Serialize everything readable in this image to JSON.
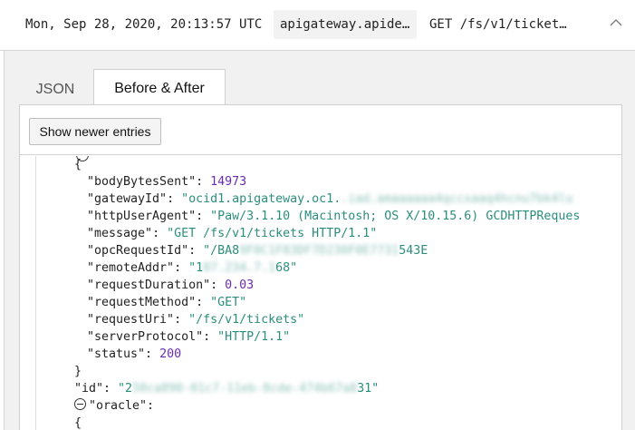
{
  "header": {
    "timestamp": "Mon, Sep 28, 2020, 20:13:57 UTC",
    "source_chip": "apigateway.apide…",
    "request": "GET /fs/v1/ticket…",
    "collapse_icon": "chevron-up-icon"
  },
  "tabs": [
    {
      "label": "JSON",
      "active": false
    },
    {
      "label": "Before & After",
      "active": true
    }
  ],
  "toolbar": {
    "show_newer_label": "Show newer entries"
  },
  "colors": {
    "key": "#222222",
    "number": "#6a2ab4",
    "string": "#2b8e7c",
    "panel_bg": "#f1f1f1"
  },
  "log": {
    "open_brace": "{",
    "close_brace": "}",
    "fields": [
      {
        "key": "\"bodyBytesSent\"",
        "sep": ": ",
        "value": "14973",
        "type": "number",
        "comma": ""
      },
      {
        "key": "\"gatewayId\"",
        "sep": ": ",
        "value": "\"ocid1.apigateway.oc1.",
        "blurred": ".iad.amaaaaaa4qccxaaq4hcnu7bk4lu",
        "type": "string",
        "comma": ""
      },
      {
        "key": "\"httpUserAgent\"",
        "sep": ": ",
        "value": "\"Paw/3.1.10 (Macintosh; OS X/10.15.6) GCDHTTPReques",
        "type": "string",
        "comma": ""
      },
      {
        "key": "\"message\"",
        "sep": ": ",
        "value": "\"GET /fs/v1/tickets HTTP/1.1\"",
        "type": "string",
        "comma": ""
      },
      {
        "key": "\"opcRequestId\"",
        "sep": ": ",
        "value": "\"/BA8",
        "blurred": "9F0C1F83DF7D230F0E7731",
        "value_tail": "543E",
        "type": "string",
        "comma": ""
      },
      {
        "key": "\"remoteAddr\"",
        "sep": ": ",
        "value": "\"1",
        "blurred": "07.234.7.1",
        "value_tail": "68\"",
        "type": "string",
        "comma": ""
      },
      {
        "key": "\"requestDuration\"",
        "sep": ": ",
        "value": "0.03",
        "type": "number",
        "comma": ""
      },
      {
        "key": "\"requestMethod\"",
        "sep": ": ",
        "value": "\"GET\"",
        "type": "string",
        "comma": ""
      },
      {
        "key": "\"requestUri\"",
        "sep": ": ",
        "value": "\"/fs/v1/tickets\"",
        "type": "string",
        "comma": ""
      },
      {
        "key": "\"serverProtocol\"",
        "sep": ": ",
        "value": "\"HTTP/1.1\"",
        "type": "string",
        "comma": ""
      },
      {
        "key": "\"status\"",
        "sep": ": ",
        "value": "200",
        "type": "number",
        "comma": ""
      }
    ],
    "id_key": "\"id\"",
    "id_sep": ": ",
    "id_value_head": "\"2",
    "id_value_blur": "50ca890-01c7-11eb-8cde-474b67a8",
    "id_value_tail": "31\"",
    "oracle_key": "\"oracle\"",
    "oracle_sep": ":",
    "oracle_brace": "{"
  }
}
